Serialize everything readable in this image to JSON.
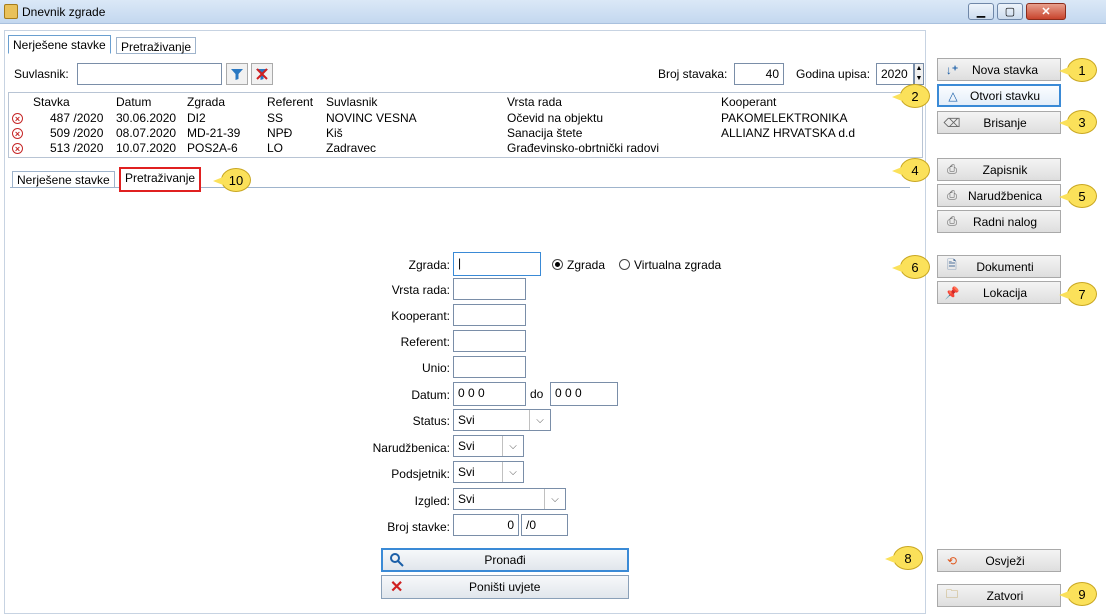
{
  "window": {
    "title": "Dnevnik zgrade",
    "controls": {
      "minimize": "▁",
      "maximize": "▢",
      "close": "✕"
    }
  },
  "tabs_top": [
    {
      "label": "Nerješene stavke"
    },
    {
      "label": "Pretraživanje"
    }
  ],
  "toolbar": {
    "suvlasnik_label": "Suvlasnik:",
    "suvlasnik_value": "",
    "broj_stavaka_label": "Broj stavaka:",
    "broj_stavaka_value": "40",
    "godina_label": "Godina upisa:",
    "godina_value": "2020"
  },
  "grid": {
    "headers": [
      "Stavka",
      "Datum",
      "Zgrada",
      "Referent",
      "Suvlasnik",
      "Vrsta rada",
      "Kooperant"
    ],
    "rows": [
      [
        "487 /2020",
        "30.06.2020",
        "DI2",
        "SS",
        "NOVINC VESNA",
        "Očevid na objektu",
        "PAKOMELEKTRONIKA"
      ],
      [
        "509 /2020",
        "08.07.2020",
        "MD-21-39",
        "NPĐ",
        "Kiš",
        "Sanacija štete",
        "ALLIANZ HRVATSKA d.d"
      ],
      [
        "513 /2020",
        "10.07.2020",
        "POS2A-6",
        "LO",
        "Zadravec",
        "Građevinsko-obrtnički radovi",
        ""
      ]
    ]
  },
  "tabs_inner": [
    {
      "label": "Nerješene stavke"
    },
    {
      "label": "Pretraživanje"
    }
  ],
  "search": {
    "zgrada_label": "Zgrada:",
    "zgrada_value": "|",
    "radio_zgrada": "Zgrada",
    "radio_virtualna": "Virtualna zgrada",
    "vrsta_rada_label": "Vrsta rada:",
    "kooperant_label": "Kooperant:",
    "referent_label": "Referent:",
    "unio_label": "Unio:",
    "datum_label": "Datum:",
    "datum_from": "0 0  0",
    "do_label": "do",
    "datum_to": "0 0  0",
    "status_label": "Status:",
    "status_value": "Svi",
    "narudzbenica_label": "Narudžbenica:",
    "narudzbenica_value": "Svi",
    "podsjetnik_label": "Podsjetnik:",
    "podsjetnik_value": "Svi",
    "izgled_label": "Izgled:",
    "izgled_value": "Svi",
    "broj_stavke_label": "Broj stavke:",
    "broj_stavke_num": "0",
    "broj_stavke_year": "/0",
    "pronadi": "Pronađi",
    "ponisti": "Poništi uvjete"
  },
  "side_buttons": {
    "nova_stavka": "Nova stavka",
    "otvori_stavku": "Otvori stavku",
    "brisanje": "Brisanje",
    "zapisnik": "Zapisnik",
    "narudzbenica": "Narudžbenica",
    "radni_nalog": "Radni nalog",
    "dokumenti": "Dokumenti",
    "lokacija": "Lokacija",
    "osvjezi": "Osvježi",
    "zatvori": "Zatvori"
  },
  "callouts": [
    "1",
    "2",
    "3",
    "4",
    "5",
    "6",
    "7",
    "8",
    "9",
    "10"
  ],
  "colors": {
    "accent": "#3a8ad6",
    "callout": "#fbe15a",
    "highlight": "#e02020"
  }
}
